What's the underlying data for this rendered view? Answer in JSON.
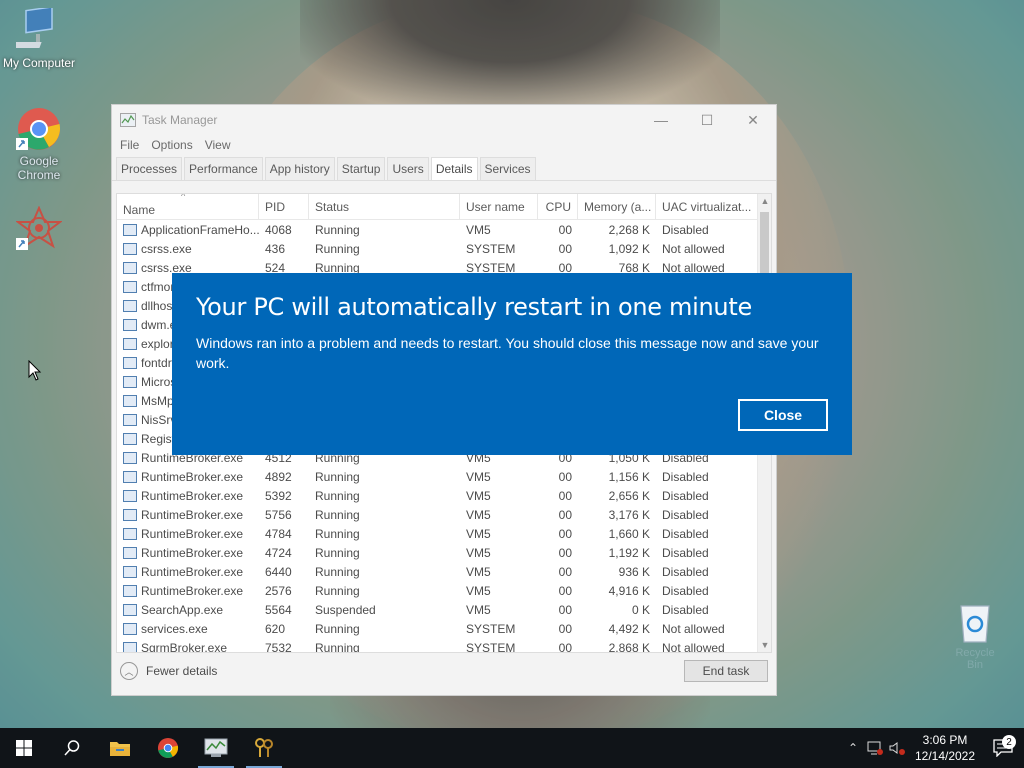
{
  "desktop": {
    "icons": [
      {
        "label": "My Computer"
      },
      {
        "label": "Google Chrome"
      },
      {
        "label": ""
      }
    ],
    "recycle_bin_label": "Recycle Bin"
  },
  "task_manager": {
    "title": "Task Manager",
    "menu": [
      "File",
      "Options",
      "View"
    ],
    "tabs": [
      "Processes",
      "Performance",
      "App history",
      "Startup",
      "Users",
      "Details",
      "Services"
    ],
    "active_tab": "Details",
    "columns": [
      "Name",
      "PID",
      "Status",
      "User name",
      "CPU",
      "Memory (a...",
      "UAC virtualizat..."
    ],
    "rows": [
      {
        "name": "ApplicationFrameHo...",
        "pid": "4068",
        "status": "Running",
        "user": "VM5",
        "cpu": "00",
        "mem": "2,268 K",
        "uac": "Disabled"
      },
      {
        "name": "csrss.exe",
        "pid": "436",
        "status": "Running",
        "user": "SYSTEM",
        "cpu": "00",
        "mem": "1,092 K",
        "uac": "Not allowed"
      },
      {
        "name": "csrss.exe",
        "pid": "524",
        "status": "Running",
        "user": "SYSTEM",
        "cpu": "00",
        "mem": "768 K",
        "uac": "Not allowed"
      },
      {
        "name": "ctfmon",
        "pid": "",
        "status": "",
        "user": "",
        "cpu": "",
        "mem": "",
        "uac": ""
      },
      {
        "name": "dllhost",
        "pid": "",
        "status": "",
        "user": "",
        "cpu": "",
        "mem": "",
        "uac": ""
      },
      {
        "name": "dwm.ex",
        "pid": "",
        "status": "",
        "user": "",
        "cpu": "",
        "mem": "",
        "uac": ""
      },
      {
        "name": "explore",
        "pid": "",
        "status": "",
        "user": "",
        "cpu": "",
        "mem": "",
        "uac": ""
      },
      {
        "name": "fontdrv",
        "pid": "",
        "status": "",
        "user": "",
        "cpu": "",
        "mem": "",
        "uac": ""
      },
      {
        "name": "Micros",
        "pid": "",
        "status": "",
        "user": "",
        "cpu": "",
        "mem": "",
        "uac": ""
      },
      {
        "name": "MsMpE",
        "pid": "",
        "status": "",
        "user": "",
        "cpu": "",
        "mem": "",
        "uac": ""
      },
      {
        "name": "NisSrv.",
        "pid": "",
        "status": "",
        "user": "",
        "cpu": "",
        "mem": "",
        "uac": ""
      },
      {
        "name": "Registr",
        "pid": "",
        "status": "",
        "user": "",
        "cpu": "",
        "mem": "",
        "uac": ""
      },
      {
        "name": "RuntimeBroker.exe",
        "pid": "4512",
        "status": "Running",
        "user": "VM5",
        "cpu": "00",
        "mem": "1,050 K",
        "uac": "Disabled"
      },
      {
        "name": "RuntimeBroker.exe",
        "pid": "4892",
        "status": "Running",
        "user": "VM5",
        "cpu": "00",
        "mem": "1,156 K",
        "uac": "Disabled"
      },
      {
        "name": "RuntimeBroker.exe",
        "pid": "5392",
        "status": "Running",
        "user": "VM5",
        "cpu": "00",
        "mem": "2,656 K",
        "uac": "Disabled"
      },
      {
        "name": "RuntimeBroker.exe",
        "pid": "5756",
        "status": "Running",
        "user": "VM5",
        "cpu": "00",
        "mem": "3,176 K",
        "uac": "Disabled"
      },
      {
        "name": "RuntimeBroker.exe",
        "pid": "4784",
        "status": "Running",
        "user": "VM5",
        "cpu": "00",
        "mem": "1,660 K",
        "uac": "Disabled"
      },
      {
        "name": "RuntimeBroker.exe",
        "pid": "4724",
        "status": "Running",
        "user": "VM5",
        "cpu": "00",
        "mem": "1,192 K",
        "uac": "Disabled"
      },
      {
        "name": "RuntimeBroker.exe",
        "pid": "6440",
        "status": "Running",
        "user": "VM5",
        "cpu": "00",
        "mem": "936 K",
        "uac": "Disabled"
      },
      {
        "name": "RuntimeBroker.exe",
        "pid": "2576",
        "status": "Running",
        "user": "VM5",
        "cpu": "00",
        "mem": "4,916 K",
        "uac": "Disabled"
      },
      {
        "name": "SearchApp.exe",
        "pid": "5564",
        "status": "Suspended",
        "user": "VM5",
        "cpu": "00",
        "mem": "0 K",
        "uac": "Disabled"
      },
      {
        "name": "services.exe",
        "pid": "620",
        "status": "Running",
        "user": "SYSTEM",
        "cpu": "00",
        "mem": "4,492 K",
        "uac": "Not allowed"
      },
      {
        "name": "SgrmBroker.exe",
        "pid": "7532",
        "status": "Running",
        "user": "SYSTEM",
        "cpu": "00",
        "mem": "2,868 K",
        "uac": "Not allowed"
      }
    ],
    "fewer_details_label": "Fewer details",
    "end_task_label": "End task"
  },
  "dialog": {
    "title": "Your PC will automatically restart in one minute",
    "message": "Windows ran into a problem and needs to restart. You should close this message now and save your work.",
    "close_label": "Close",
    "color": "#0067b8"
  },
  "taskbar": {
    "apps": [
      "start-icon",
      "search-icon",
      "file-explorer-icon",
      "chrome-icon",
      "task-manager-icon",
      "keys-icon"
    ],
    "time": "3:06 PM",
    "date": "12/14/2022",
    "notification_count": "2"
  }
}
